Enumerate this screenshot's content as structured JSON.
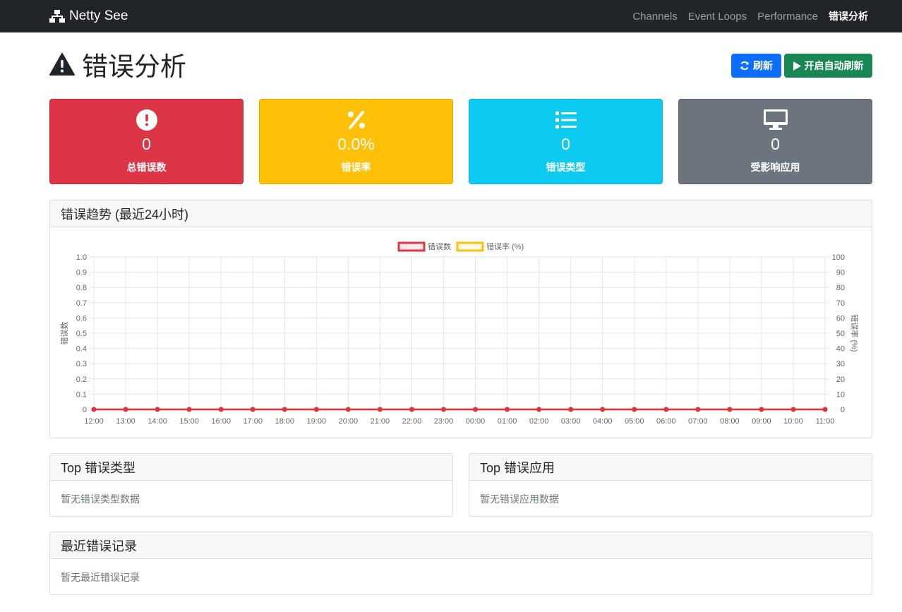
{
  "navbar": {
    "brand": "Netty See",
    "links": [
      "Channels",
      "Event Loops",
      "Performance",
      "错误分析"
    ],
    "active_index": 3
  },
  "page": {
    "title": "错误分析",
    "refresh_label": "刷新",
    "auto_refresh_label": "开启自动刷新"
  },
  "stats": [
    {
      "value": "0",
      "label": "总错误数",
      "icon": "exclamation-circle-icon",
      "color": "#dc3545"
    },
    {
      "value": "0.0%",
      "label": "错误率",
      "icon": "percent-icon",
      "color": "#ffc107"
    },
    {
      "value": "0",
      "label": "错误类型",
      "icon": "list-icon",
      "color": "#0dcaf0"
    },
    {
      "value": "0",
      "label": "受影响应用",
      "icon": "desktop-icon",
      "color": "#6c757d"
    }
  ],
  "trend": {
    "title": "错误趋势 (最近24小时)"
  },
  "chart_data": {
    "type": "line",
    "x": [
      "12:00",
      "13:00",
      "14:00",
      "15:00",
      "16:00",
      "17:00",
      "18:00",
      "19:00",
      "20:00",
      "21:00",
      "22:00",
      "23:00",
      "00:00",
      "01:00",
      "02:00",
      "03:00",
      "04:00",
      "05:00",
      "06:00",
      "07:00",
      "08:00",
      "09:00",
      "10:00",
      "11:00"
    ],
    "series": [
      {
        "name": "错误数",
        "axis": "left",
        "color": "#dc3545",
        "values": [
          0,
          0,
          0,
          0,
          0,
          0,
          0,
          0,
          0,
          0,
          0,
          0,
          0,
          0,
          0,
          0,
          0,
          0,
          0,
          0,
          0,
          0,
          0,
          0
        ]
      },
      {
        "name": "错误率 (%)",
        "axis": "right",
        "color": "#ffc107",
        "values": [
          0,
          0,
          0,
          0,
          0,
          0,
          0,
          0,
          0,
          0,
          0,
          0,
          0,
          0,
          0,
          0,
          0,
          0,
          0,
          0,
          0,
          0,
          0,
          0
        ]
      }
    ],
    "y_left": {
      "label": "错误数",
      "range": [
        0,
        1.0
      ],
      "ticks": [
        "0",
        "0.1",
        "0.2",
        "0.3",
        "0.4",
        "0.5",
        "0.6",
        "0.7",
        "0.8",
        "0.9",
        "1.0"
      ]
    },
    "y_right": {
      "label": "错误率 (%)",
      "range": [
        0,
        100
      ],
      "ticks": [
        "0",
        "10",
        "20",
        "30",
        "40",
        "50",
        "60",
        "70",
        "80",
        "90",
        "100"
      ]
    },
    "grid": true,
    "legend": "top"
  },
  "top_types": {
    "title": "Top 错误类型",
    "empty_text": "暂无错误类型数据"
  },
  "top_apps": {
    "title": "Top 错误应用",
    "empty_text": "暂无错误应用数据"
  },
  "recent": {
    "title": "最近错误记录",
    "empty_text": "暂无最近错误记录"
  }
}
